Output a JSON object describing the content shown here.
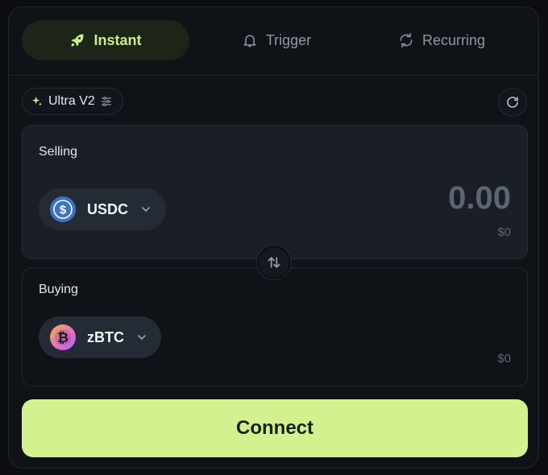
{
  "tabs": [
    {
      "label": "Instant",
      "icon": "rocket-icon",
      "active": true
    },
    {
      "label": "Trigger",
      "icon": "bell-icon",
      "active": false
    },
    {
      "label": "Recurring",
      "icon": "repeat-icon",
      "active": false
    }
  ],
  "mode": {
    "label": "Ultra V2",
    "icon": "sparkle-icon",
    "settings_icon": "sliders-icon"
  },
  "refresh_icon": "refresh-icon",
  "selling": {
    "label": "Selling",
    "token": "USDC",
    "token_icon": "usdc-icon",
    "amount": "0.00",
    "usd_value": "$0"
  },
  "swap_icon": "swap-arrows-icon",
  "buying": {
    "label": "Buying",
    "token": "zBTC",
    "token_icon": "bitcoin-icon",
    "usd_value": "$0"
  },
  "connect_label": "Connect",
  "colors": {
    "accent": "#d3f28f",
    "active_tab_text": "#c8ef8a",
    "background": "#0f1217",
    "usdc_blue": "#3e73c4"
  }
}
